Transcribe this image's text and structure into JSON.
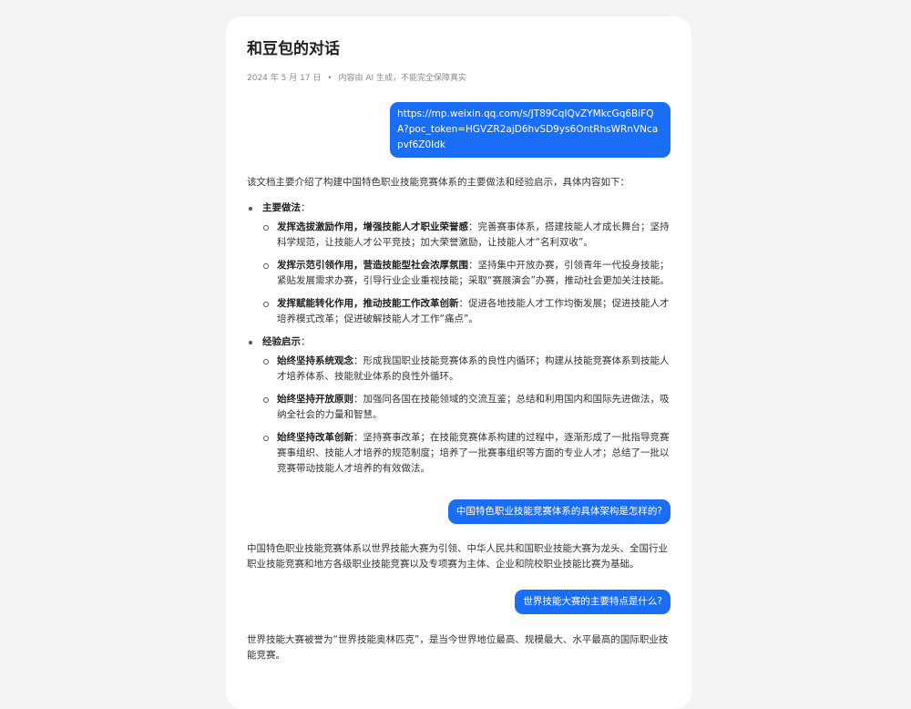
{
  "header": {
    "title": "和豆包的对话",
    "date": "2024 年 5 月 17 日",
    "separator": "•",
    "disclaimer": "内容由 AI 生成，不能完全保障真实"
  },
  "messages": {
    "user_1": "https://mp.weixin.qq.com/s/JT89CqIQvZYMkcGq6BiFQA?poc_token=HGVZR2ajD6hvSD9ys6OntRhsWRnVNcapvf6Z0Idk",
    "answer_1": {
      "intro": "该文档主要介绍了构建中国特色职业技能竞赛体系的主要做法和经验启示，具体内容如下：",
      "sections": [
        {
          "heading": "主要做法",
          "items": [
            {
              "bold": "发挥选拔激励作用，增强技能人才职业荣誉感",
              "text": "：完善赛事体系，搭建技能人才成长舞台；坚持科学规范，让技能人才公平竞技；加大荣誉激励，让技能人才“名利双收”。"
            },
            {
              "bold": "发挥示范引领作用，营造技能型社会浓厚氛围",
              "text": "：坚持集中开放办赛，引领青年一代投身技能；紧贴发展需求办赛，引导行业企业重视技能；采取“赛展演会”办赛，推动社会更加关注技能。"
            },
            {
              "bold": "发挥赋能转化作用，推动技能工作改革创新",
              "text": "：促进各地技能人才工作均衡发展；促进技能人才培养模式改革；促进破解技能人才工作“痛点”。"
            }
          ]
        },
        {
          "heading": "经验启示",
          "items": [
            {
              "bold": "始终坚持系统观念",
              "text": "：形成我国职业技能竞赛体系的良性内循环；构建从技能竞赛体系到技能人才培养体系、技能就业体系的良性外循环。"
            },
            {
              "bold": "始终坚持开放原则",
              "text": "：加强同各国在技能领域的交流互鉴；总结和利用国内和国际先进做法，吸纳全社会的力量和智慧。"
            },
            {
              "bold": "始终坚持改革创新",
              "text": "：坚持赛事改革；在技能竞赛体系构建的过程中，逐渐形成了一批指导竞赛赛事组织、技能人才培养的规范制度；培养了一批赛事组织等方面的专业人才；总结了一批以竞赛带动技能人才培养的有效做法。"
            }
          ]
        }
      ],
      "colon": "："
    },
    "user_2": "中国特色职业技能竞赛体系的具体架构是怎样的?",
    "answer_2": "中国特色职业技能竞赛体系以世界技能大赛为引领、中华人民共和国职业技能大赛为龙头、全国行业职业技能竞赛和地方各级职业技能竞赛以及专项赛为主体、企业和院校职业技能比赛为基础。",
    "user_3": "世界技能大赛的主要特点是什么?",
    "answer_3": "世界技能大赛被誉为“世界技能奥林匹克”，是当今世界地位最高、规模最大、水平最高的国际职业技能竞赛。"
  }
}
